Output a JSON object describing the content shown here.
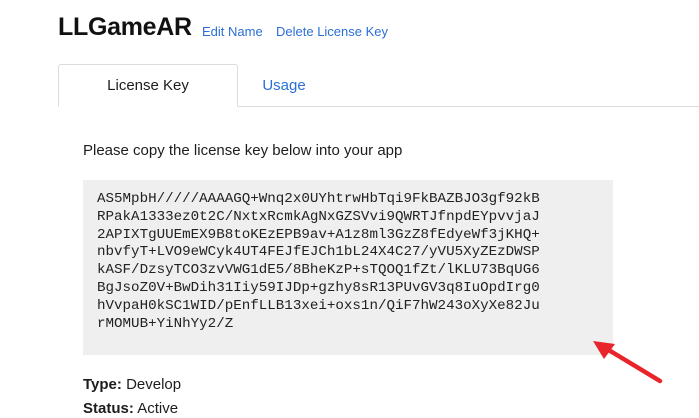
{
  "header": {
    "app_name": "LLGameAR",
    "edit_name_label": "Edit Name",
    "delete_license_label": "Delete License Key"
  },
  "tabs": [
    {
      "label": "License Key",
      "active": true
    },
    {
      "label": "Usage",
      "active": false
    }
  ],
  "license": {
    "instructions": "Please copy the license key below into your app",
    "key_lines": [
      "AS5MpbH/////AAAAGQ+Wnq2x0UYhtrwHbTqi9FkBAZBJO3gf92kB",
      "RPakA1333ez0t2C/NxtxRcmkAgNxGZSVvi9QWRTJfnpdEYpvvjaJ",
      "2APIXTgUUEmEX9B8toKEzEPB9av+A1z8ml3GzZ8fEdyeWf3jKHQ+",
      "nbvfyT+LVO9eWCyk4UT4FEJfEJCh1bL24X4C27/yVU5XyZEzDWSP",
      "kASF/DzsyTCO3zvVWG1dE5/8BheKzP+sTQOQ1fZt/lKLU73BqUG6",
      "BgJsoZ0V+BwDih31Iiy59IJDp+gzhy8sR13PUvGV3q8IuOpdIrg0",
      "hVvpaH0kSC1WID/pEnfLLB13xei+oxs1n/QiF7hW243oXyXe82Ju",
      "rMOMUB+YiNhYy2/Z"
    ],
    "type_label": "Type:",
    "type_value": "Develop",
    "status_label": "Status:",
    "status_value": "Active"
  },
  "colors": {
    "link": "#2b6fd6",
    "key_box_bg": "#efefef",
    "annotation_arrow": "#e8252a"
  },
  "icons": {
    "annotation": "red-arrow-icon"
  }
}
